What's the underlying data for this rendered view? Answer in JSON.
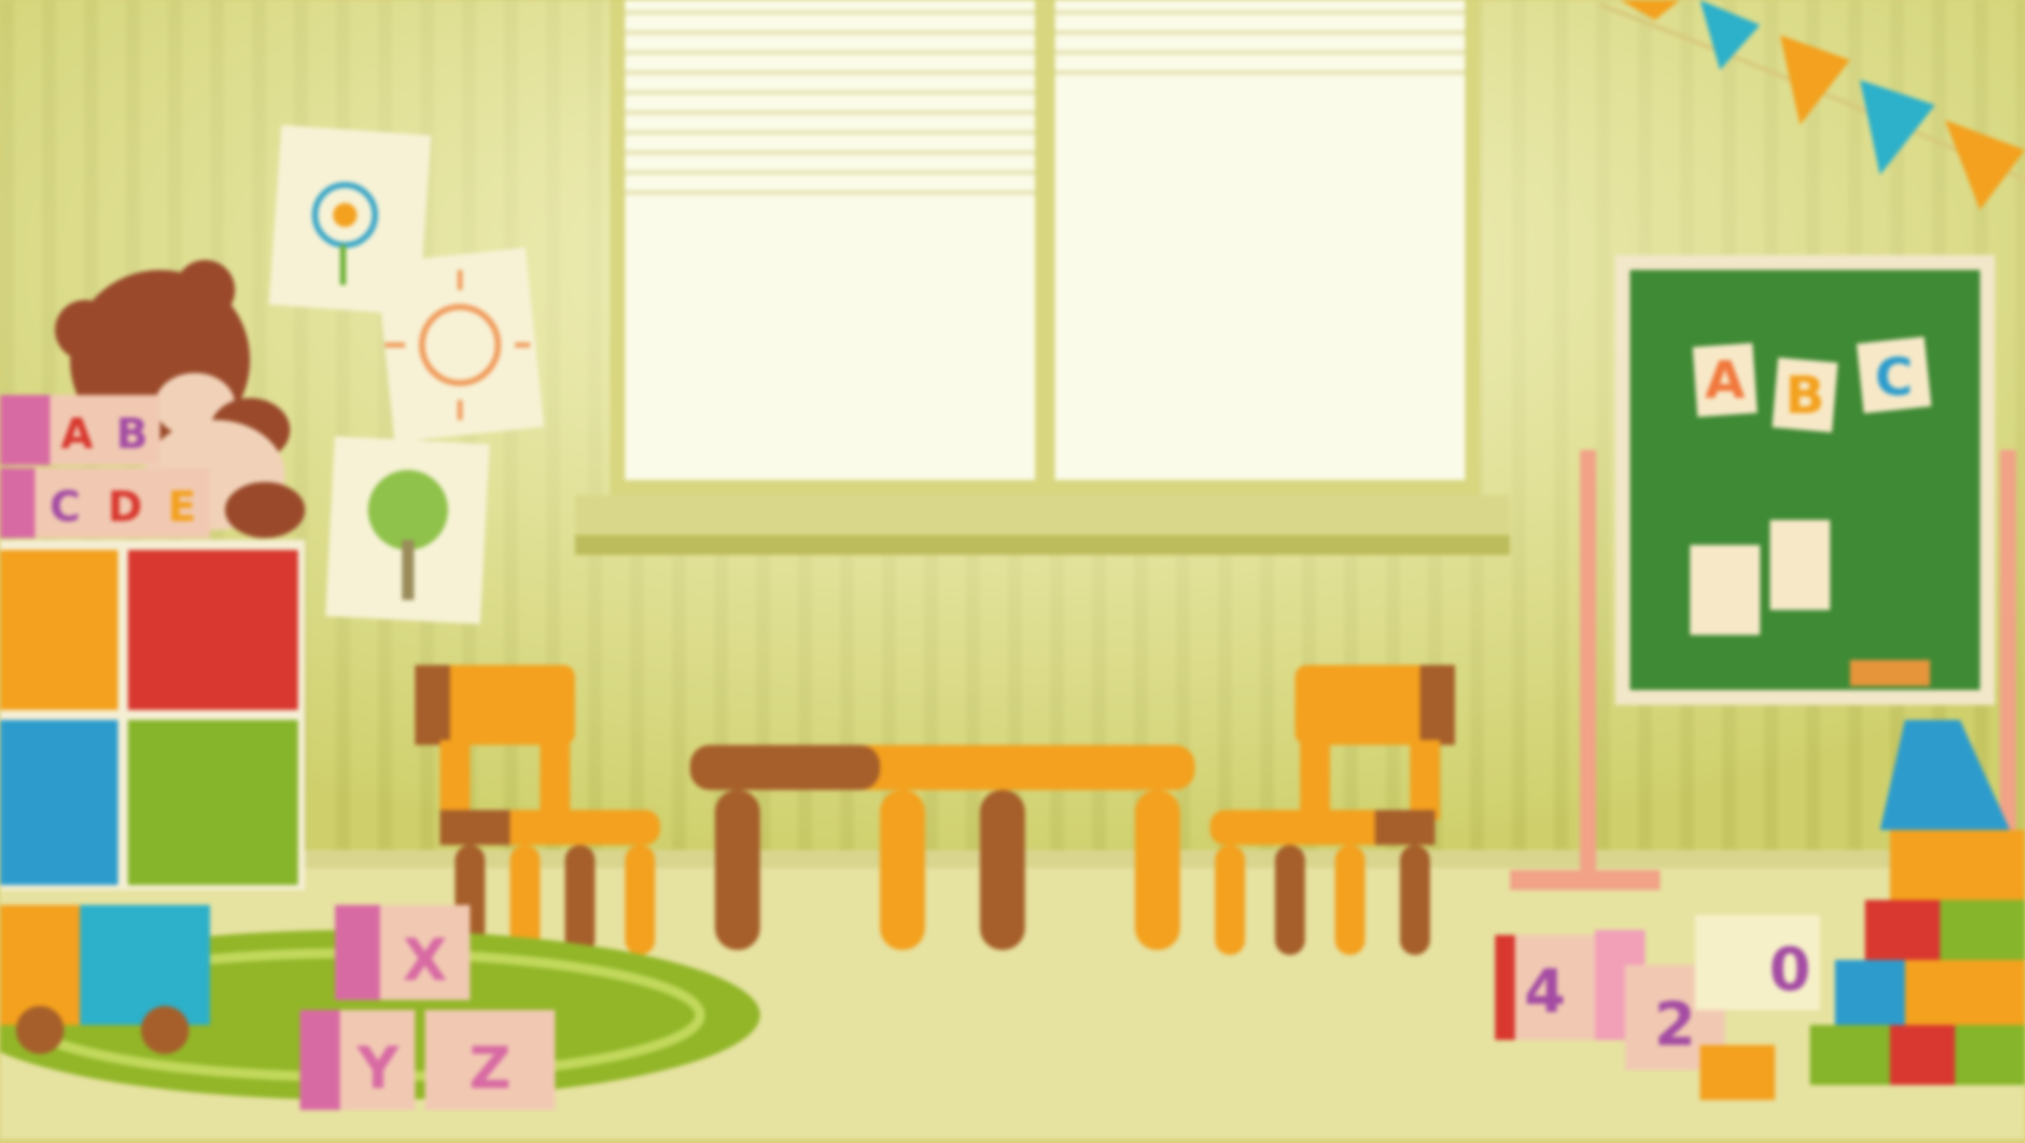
{
  "scene": {
    "description_labels": {
      "top_blocks": [
        "A",
        "B",
        "C",
        "D",
        "E"
      ],
      "bottom_left_blocks_top": [
        "X"
      ],
      "bottom_left_blocks_bottom": [
        "Y",
        "Z"
      ],
      "board_letters": [
        "A",
        "B",
        "C"
      ],
      "number_blocks": [
        "4",
        "2",
        "0"
      ]
    },
    "colors": {
      "wall": "#cfd06c",
      "wall_dark": "#b9bb55",
      "floor": "#e6e2a0",
      "window": "#fbfbe9",
      "window_frame": "#d8d67e",
      "board": "#3f8a35",
      "board_frame": "#f2e7c8",
      "orange": "#f3a11e",
      "brown": "#a65f2a",
      "red": "#d8382f",
      "blue": "#2d9ccc",
      "green": "#86b42a",
      "rug": "#92b628"
    }
  }
}
